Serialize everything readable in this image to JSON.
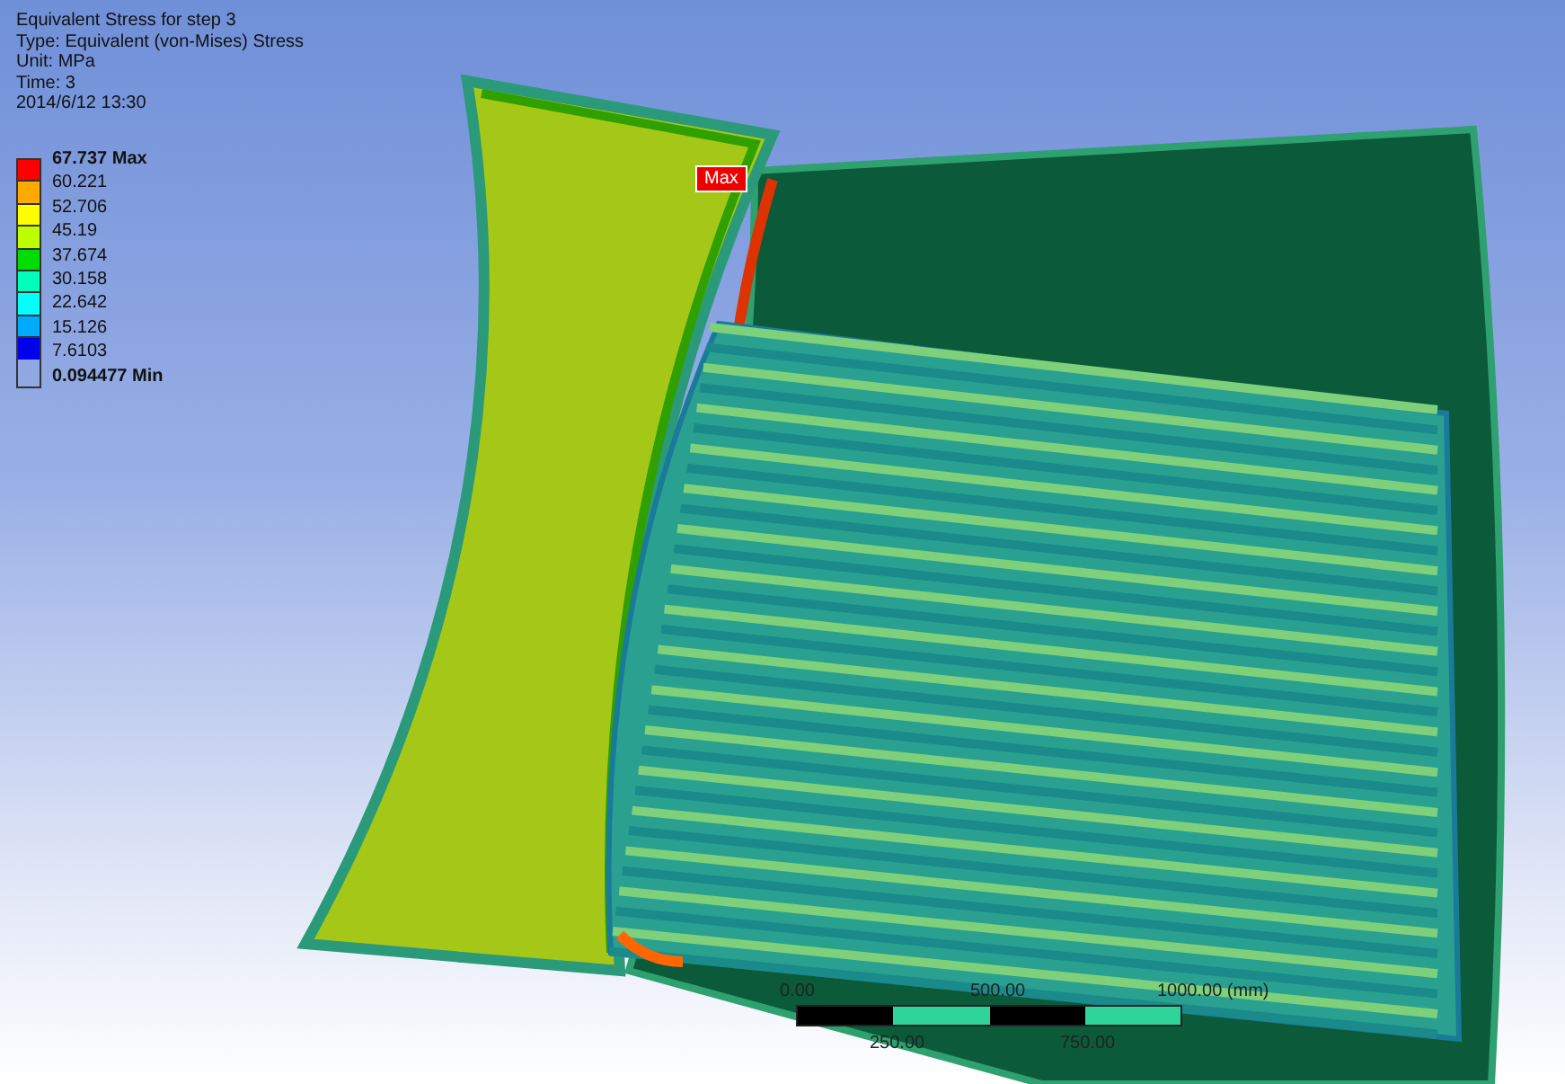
{
  "header": {
    "lines": [
      "Equivalent Stress for step 3",
      "Type: Equivalent (von-Mises) Stress",
      "Unit: MPa",
      "Time: 3",
      "2014/6/12 13:30"
    ]
  },
  "legend": {
    "max": "67.737 Max",
    "labels": [
      "60.221",
      "52.706",
      "45.19",
      "37.674",
      "30.158",
      "22.642",
      "15.126",
      "7.6103"
    ],
    "min": "0.094477 Min",
    "bands": [
      {
        "color": "#ff0000"
      },
      {
        "color": "#ffaa00"
      },
      {
        "color": "#ffff00"
      },
      {
        "color": "#bbff00"
      },
      {
        "color": "#00dd00"
      },
      {
        "color": "#00ffbb"
      },
      {
        "color": "#00ffff"
      },
      {
        "color": "#00aaff"
      },
      {
        "color": "#0000ee"
      }
    ]
  },
  "probe": {
    "label": "Max"
  },
  "scale_bar": {
    "top_labels": [
      "0.00",
      "500.00",
      "1000.00 (mm)"
    ],
    "bottom_labels": [
      "250.00",
      "750.00"
    ]
  }
}
